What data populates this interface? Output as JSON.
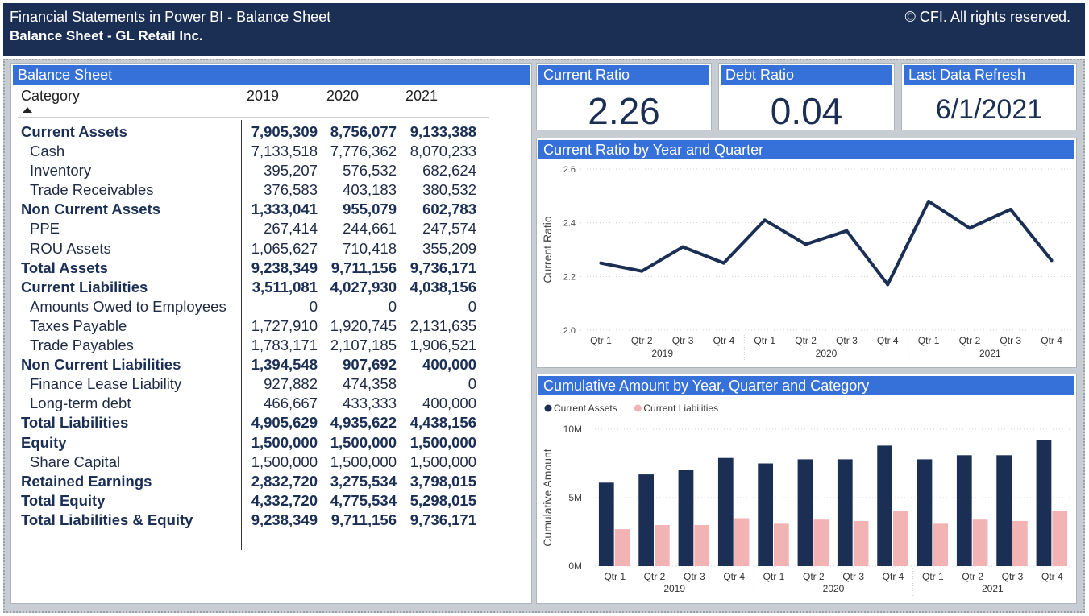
{
  "header": {
    "title": "Financial Statements in Power BI - Balance Sheet",
    "subtitle": "Balance Sheet - GL Retail Inc.",
    "copyright": "© CFI. All rights reserved."
  },
  "balance_sheet": {
    "title": "Balance Sheet",
    "columns": [
      "Category",
      "2019",
      "2020",
      "2021"
    ],
    "rows": [
      {
        "label": "Current Assets",
        "bold": true,
        "values": [
          "7,905,309",
          "8,756,077",
          "9,133,388"
        ]
      },
      {
        "label": "Cash",
        "bold": false,
        "values": [
          "7,133,518",
          "7,776,362",
          "8,070,233"
        ]
      },
      {
        "label": "Inventory",
        "bold": false,
        "values": [
          "395,207",
          "576,532",
          "682,624"
        ]
      },
      {
        "label": "Trade Receivables",
        "bold": false,
        "values": [
          "376,583",
          "403,183",
          "380,532"
        ]
      },
      {
        "label": "Non Current Assets",
        "bold": true,
        "values": [
          "1,333,041",
          "955,079",
          "602,783"
        ]
      },
      {
        "label": "PPE",
        "bold": false,
        "values": [
          "267,414",
          "244,661",
          "247,574"
        ]
      },
      {
        "label": "ROU Assets",
        "bold": false,
        "values": [
          "1,065,627",
          "710,418",
          "355,209"
        ]
      },
      {
        "label": "Total Assets",
        "bold": true,
        "values": [
          "9,238,349",
          "9,711,156",
          "9,736,171"
        ]
      },
      {
        "label": "Current Liabilities",
        "bold": true,
        "values": [
          "3,511,081",
          "4,027,930",
          "4,038,156"
        ]
      },
      {
        "label": "Amounts Owed to Employees",
        "bold": false,
        "values": [
          "0",
          "0",
          "0"
        ]
      },
      {
        "label": "Taxes Payable",
        "bold": false,
        "values": [
          "1,727,910",
          "1,920,745",
          "2,131,635"
        ]
      },
      {
        "label": "Trade Payables",
        "bold": false,
        "values": [
          "1,783,171",
          "2,107,185",
          "1,906,521"
        ]
      },
      {
        "label": "Non Current Liabilities",
        "bold": true,
        "values": [
          "1,394,548",
          "907,692",
          "400,000"
        ]
      },
      {
        "label": "Finance Lease Liability",
        "bold": false,
        "values": [
          "927,882",
          "474,358",
          "0"
        ]
      },
      {
        "label": "Long-term debt",
        "bold": false,
        "values": [
          "466,667",
          "433,333",
          "400,000"
        ]
      },
      {
        "label": "Total Liabilities",
        "bold": true,
        "values": [
          "4,905,629",
          "4,935,622",
          "4,438,156"
        ]
      },
      {
        "label": "Equity",
        "bold": true,
        "values": [
          "1,500,000",
          "1,500,000",
          "1,500,000"
        ]
      },
      {
        "label": "Share Capital",
        "bold": false,
        "values": [
          "1,500,000",
          "1,500,000",
          "1,500,000"
        ]
      },
      {
        "label": "Retained Earnings",
        "bold": true,
        "values": [
          "2,832,720",
          "3,275,534",
          "3,798,015"
        ]
      },
      {
        "label": "Total Equity",
        "bold": true,
        "values": [
          "4,332,720",
          "4,775,534",
          "5,298,015"
        ]
      },
      {
        "label": "Total Liabilities & Equity",
        "bold": true,
        "values": [
          "9,238,349",
          "9,711,156",
          "9,736,171"
        ]
      }
    ]
  },
  "kpis": {
    "current_ratio": {
      "label": "Current Ratio",
      "value": "2.26"
    },
    "debt_ratio": {
      "label": "Debt Ratio",
      "value": "0.04"
    },
    "last_refresh": {
      "label": "Last Data Refresh",
      "value": "6/1/2021"
    }
  },
  "colors": {
    "navy": "#1b2f55",
    "accent_blue": "#3670d9",
    "pink": "#f1b3b3"
  },
  "chart_data": [
    {
      "type": "line",
      "title": "Current Ratio by Year and Quarter",
      "ylabel": "Current Ratio",
      "xlabel": "",
      "categories": [
        "Qtr 1",
        "Qtr 2",
        "Qtr 3",
        "Qtr 4",
        "Qtr 1",
        "Qtr 2",
        "Qtr 3",
        "Qtr 4",
        "Qtr 1",
        "Qtr 2",
        "Qtr 3",
        "Qtr 4"
      ],
      "groups": [
        "2019",
        "2020",
        "2021"
      ],
      "yticks": [
        "2.0",
        "2.2",
        "2.4",
        "2.6"
      ],
      "ylim": [
        2.0,
        2.6
      ],
      "series": [
        {
          "values": [
            2.25,
            2.22,
            2.31,
            2.25,
            2.41,
            2.32,
            2.37,
            2.17,
            2.48,
            2.38,
            2.45,
            2.26
          ]
        }
      ],
      "grid": true
    },
    {
      "type": "bar",
      "title": "Cumulative Amount by Year, Quarter and Category",
      "ylabel": "Cumulative Amount",
      "xlabel": "",
      "categories": [
        "Qtr 1",
        "Qtr 2",
        "Qtr 3",
        "Qtr 4",
        "Qtr 1",
        "Qtr 2",
        "Qtr 3",
        "Qtr 4",
        "Qtr 1",
        "Qtr 2",
        "Qtr 3",
        "Qtr 4"
      ],
      "groups": [
        "2019",
        "2020",
        "2021"
      ],
      "yticks": [
        "0M",
        "5M",
        "10M"
      ],
      "ylim": [
        0,
        10
      ],
      "legend": "top-left",
      "series": [
        {
          "name": "Current Assets",
          "color": "#1b2f55",
          "values": [
            6.1,
            6.7,
            7.0,
            7.9,
            7.5,
            7.8,
            7.8,
            8.8,
            7.8,
            8.1,
            8.1,
            9.2
          ]
        },
        {
          "name": "Current Liabilities",
          "color": "#f1b3b3",
          "values": [
            2.7,
            3.0,
            3.0,
            3.5,
            3.1,
            3.4,
            3.3,
            4.0,
            3.1,
            3.4,
            3.3,
            4.0
          ]
        }
      ],
      "grid": true
    }
  ]
}
